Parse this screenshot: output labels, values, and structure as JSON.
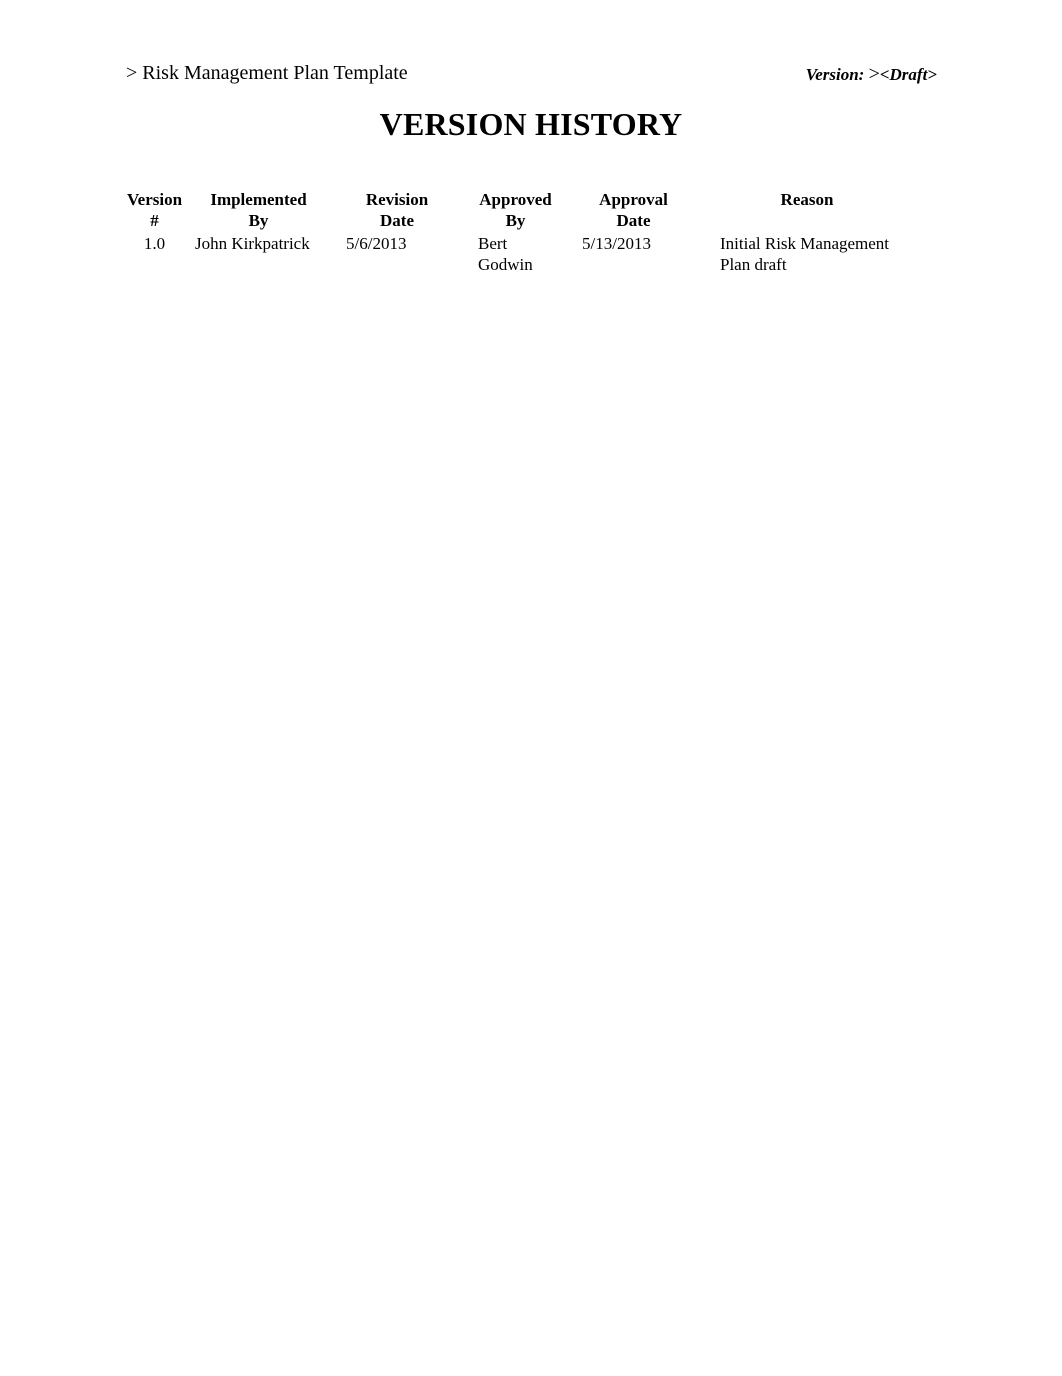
{
  "header": {
    "doc_title": "> Risk Management Plan Template",
    "version_label": "Version:",
    "version_gt": ">",
    "version_value": "<Draft>"
  },
  "title": "VERSION HISTORY",
  "table": {
    "columns": [
      {
        "line1": "Version",
        "line2": "#"
      },
      {
        "line1": "Implemented",
        "line2": "By"
      },
      {
        "line1": "Revision",
        "line2": "Date"
      },
      {
        "line1": "Approved",
        "line2": "By"
      },
      {
        "line1": "Approval",
        "line2": "Date"
      },
      {
        "line1": "Reason",
        "line2": ""
      }
    ],
    "rows": [
      {
        "version": "1.0",
        "implemented_by": "John Kirkpatrick",
        "revision_date": "5/6/2013",
        "approved_by_line1": "Bert",
        "approved_by_line2": "Godwin",
        "approval_date": "5/13/2013",
        "reason_line1": "Initial Risk Management",
        "reason_line2": "Plan draft"
      }
    ]
  }
}
